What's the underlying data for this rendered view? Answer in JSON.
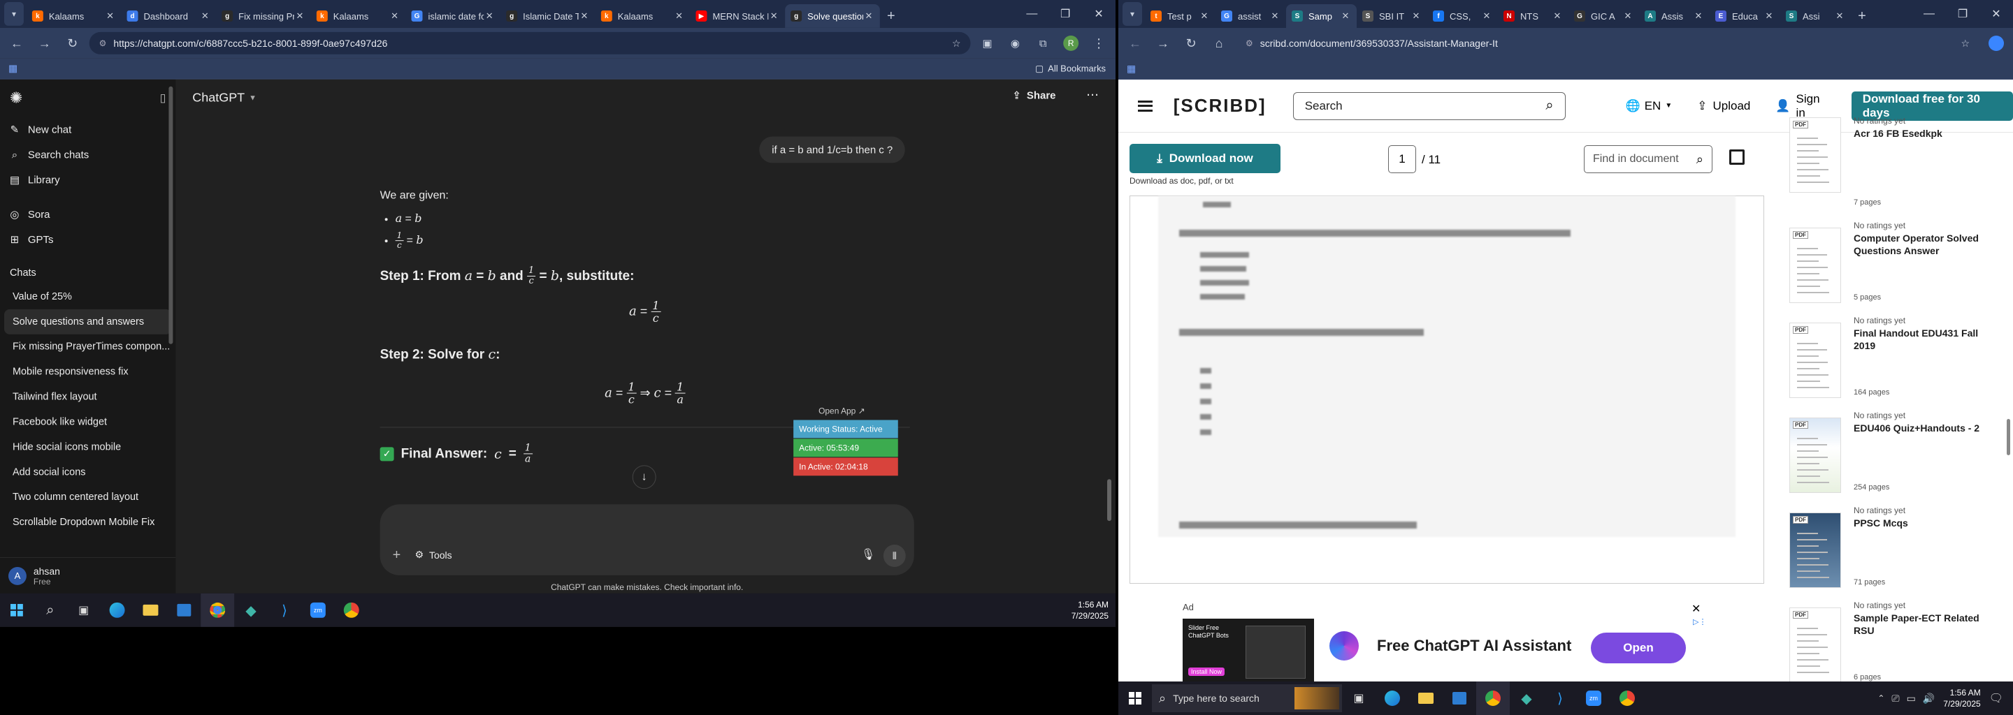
{
  "left_window": {
    "tabs": [
      {
        "title": "Kalaams",
        "fav": "k",
        "color": "#ff6a00"
      },
      {
        "title": "Dashboard",
        "fav": "d",
        "color": "#3d7bea"
      },
      {
        "title": "Fix missing Pra",
        "fav": "g",
        "color": "#2b2b2b"
      },
      {
        "title": "Kalaams",
        "fav": "k",
        "color": "#ff6a00"
      },
      {
        "title": "islamic date fo",
        "fav": "G",
        "color": "#4285f4"
      },
      {
        "title": "Islamic Date To",
        "fav": "g",
        "color": "#2b2b2b"
      },
      {
        "title": "Kalaams",
        "fav": "k",
        "color": "#ff6a00"
      },
      {
        "title": "MERN Stack Ful",
        "fav": "▶",
        "color": "#ff0000"
      },
      {
        "title": "Solve question",
        "fav": "g",
        "color": "#2b2b2b"
      }
    ],
    "url": "https://chatgpt.com/c/6887ccc5-b21c-8001-899f-0ae97c497d26",
    "bookmarks_label": "All Bookmarks",
    "sidebar": {
      "top_items": [
        {
          "label": "New chat",
          "icon": "new-chat-icon"
        },
        {
          "label": "Search chats",
          "icon": "search-icon"
        },
        {
          "label": "Library",
          "icon": "library-icon"
        }
      ],
      "mid_items": [
        {
          "label": "Sora",
          "icon": "sora-icon"
        },
        {
          "label": "GPTs",
          "icon": "gpts-icon"
        }
      ],
      "chats_heading": "Chats",
      "chats": [
        "Value of 25%",
        "Solve questions and answers",
        "Fix missing PrayerTimes compon...",
        "Mobile responsiveness fix",
        "Tailwind flex layout",
        "Facebook like widget",
        "Hide social icons mobile",
        "Add social icons",
        "Two column centered layout",
        "Scrollable Dropdown Mobile Fix"
      ],
      "user": {
        "initial": "A",
        "name": "ahsan",
        "plan": "Free"
      }
    },
    "header": {
      "model": "ChatGPT",
      "share": "Share"
    },
    "conversation": {
      "user_message": "if a = b and 1/c=b then c ?",
      "intro": "We are given:",
      "step1": "Step 1: From",
      "step1_and": "and",
      "step1_end": ", substitute:",
      "step2": "Step 2: Solve for",
      "final": "Final Answer:"
    },
    "overlay": {
      "open_app": "Open App ↗",
      "working": "Working Status: Active",
      "active": "Active: 05:53:49",
      "inactive": "In Active: 02:04:18"
    },
    "composer": {
      "tools": "Tools"
    },
    "disclaimer": "ChatGPT can make mistakes. Check important info.",
    "clock": {
      "time": "1:56 AM",
      "date": "7/29/2025"
    }
  },
  "right_window": {
    "tabs": [
      {
        "title": "Test p",
        "fav": "t",
        "color": "#ff6a00"
      },
      {
        "title": "assist",
        "fav": "G",
        "color": "#4285f4"
      },
      {
        "title": "Samp",
        "fav": "S",
        "color": "#1e7b85"
      },
      {
        "title": "SBI IT",
        "fav": "S",
        "color": "#555"
      },
      {
        "title": "CSS, ",
        "fav": "f",
        "color": "#1877f2"
      },
      {
        "title": "NTS",
        "fav": "N",
        "color": "#c00"
      },
      {
        "title": "GIC A",
        "fav": "G",
        "color": "#333"
      },
      {
        "title": "Assis",
        "fav": "A",
        "color": "#1e7b85"
      },
      {
        "title": "Educa",
        "fav": "E",
        "color": "#4b5cd1"
      },
      {
        "title": "Assi",
        "fav": "S",
        "color": "#1e7b85"
      }
    ],
    "url": "scribd.com/document/369530337/Assistant-Manager-It",
    "scribd": {
      "logo": "[SCRIBD]",
      "search_placeholder": "Search",
      "lang": "EN",
      "upload": "Upload",
      "signin": "Sign in",
      "cta": "Download free for 30 days",
      "download_now": "Download now",
      "download_as": "Download as doc, pdf, or txt",
      "page_current": "1",
      "page_total": "/ 11",
      "find_placeholder": "Find in document"
    },
    "recommendations": [
      {
        "rating": "No ratings yet",
        "title": "Acr 16 FB Esedkpk",
        "pages": "7 pages",
        "badge": "PDF"
      },
      {
        "rating": "No ratings yet",
        "title": "Computer Operator Solved Questions Answer",
        "pages": "5 pages",
        "badge": "PDF"
      },
      {
        "rating": "No ratings yet",
        "title": "Final Handout EDU431 Fall 2019",
        "pages": "164 pages",
        "badge": "PDF"
      },
      {
        "rating": "No ratings yet",
        "title": "EDU406 Quiz+Handouts - 2",
        "pages": "254 pages",
        "badge": "PDF"
      },
      {
        "rating": "No ratings yet",
        "title": "PPSC Mcqs",
        "pages": "71 pages",
        "badge": "PDF"
      },
      {
        "rating": "No ratings yet",
        "title": "Sample Paper-ECT Related RSU",
        "pages": "6 pages",
        "badge": "PDF"
      }
    ],
    "ad": {
      "label": "Ad",
      "text": "Free ChatGPT AI Assistant",
      "button": "Open",
      "thumb_title": "Slider Free ChatGPT Bots",
      "thumb_sub": "Install Now"
    },
    "taskbar": {
      "search_placeholder": "Type here to search",
      "time": "1:56 AM",
      "date": "7/29/2025"
    }
  }
}
